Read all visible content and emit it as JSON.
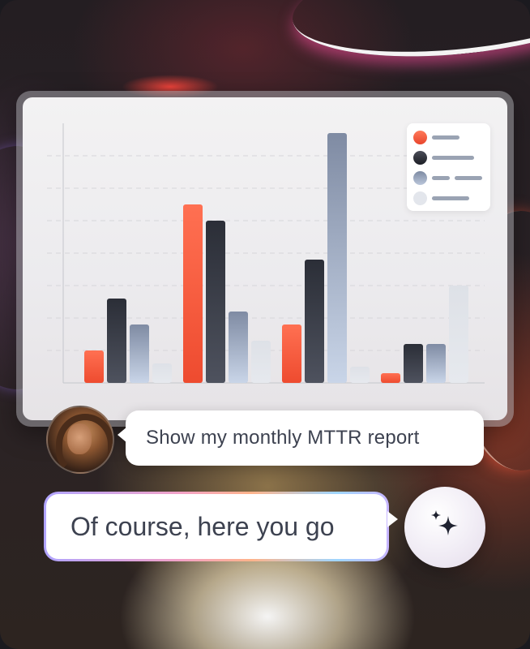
{
  "chat": {
    "user_message": "Show my monthly MTTR report",
    "assistant_message": "Of course, here you go"
  },
  "icons": {
    "avatar": "user-avatar-photo",
    "assistant": "sparkles-icon"
  },
  "colors": {
    "series1": "#f25a3c",
    "series2": "#24262e",
    "series3": "#8f9db4",
    "series4": "#dde0e6",
    "text": "#3d4250"
  },
  "chart_data": {
    "type": "bar",
    "categories": [
      "",
      "",
      "",
      ""
    ],
    "series": [
      {
        "values": [
          10,
          55,
          18,
          3
        ]
      },
      {
        "values": [
          26,
          50,
          38,
          12
        ]
      },
      {
        "values": [
          18,
          22,
          77,
          12
        ]
      },
      {
        "values": [
          6,
          13,
          5,
          30
        ]
      }
    ],
    "ylim": [
      0,
      80
    ],
    "grid": true,
    "legend": "top-right",
    "legend_entries": 4
  }
}
